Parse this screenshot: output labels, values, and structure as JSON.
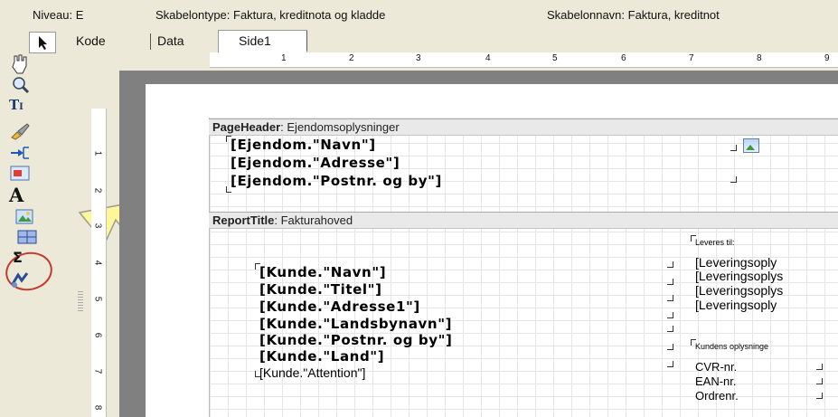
{
  "info": {
    "niveau": "Niveau: E",
    "skabelontype": "Skabelontype: Faktura, kreditnota og kladde",
    "skabelonnavn": "Skabelonnavn: Faktura, kreditnot"
  },
  "tabs": [
    "Kode",
    "Data",
    "Side1"
  ],
  "toolbar": {
    "icons": [
      "pointer-icon",
      "hand-icon",
      "zoom-icon",
      "text-tool-icon",
      "brush-icon",
      "connector-icon",
      "image-field-icon",
      "font-a-icon",
      "picture-icon",
      "grid-icon",
      "sum-icon",
      "barcode-icon"
    ]
  },
  "ruler": {
    "h_numbers": [
      "1",
      "2",
      "3",
      "4",
      "5",
      "6",
      "7",
      "8",
      "9"
    ],
    "v_numbers": [
      "1",
      "2",
      "3",
      "4",
      "5",
      "6",
      "7",
      "8"
    ]
  },
  "bands": {
    "pageheader": {
      "name": "PageHeader",
      "title": ": Ejendomsoplysninger",
      "fields": [
        "[Ejendom.\"Navn\"]",
        "[Ejendom.\"Adresse\"]",
        "[Ejendom.\"Postnr. og by\"]"
      ]
    },
    "reporttitle": {
      "name": "ReportTitle",
      "title": ": Fakturahoved",
      "fields": [
        "[Kunde.\"Navn\"]",
        "[Kunde.\"Titel\"]",
        "[Kunde.\"Adresse1\"]",
        "[Kunde.\"Landsbynavn\"]",
        "[Kunde.\"Postnr. og by\"]",
        "[Kunde.\"Land\"]"
      ],
      "attention": "[Kunde.\"Attention\"]",
      "leveres_label": "Leveres til:",
      "levering_fields": [
        "[Leveringsoply",
        "[Leveringsoplys",
        "[Leveringsoplys",
        "[Leveringsoply"
      ],
      "kundens_label": "Kundens oplysninge",
      "kunde_labels": [
        "CVR-nr.",
        "EAN-nr.",
        "Ordrenr."
      ]
    }
  }
}
